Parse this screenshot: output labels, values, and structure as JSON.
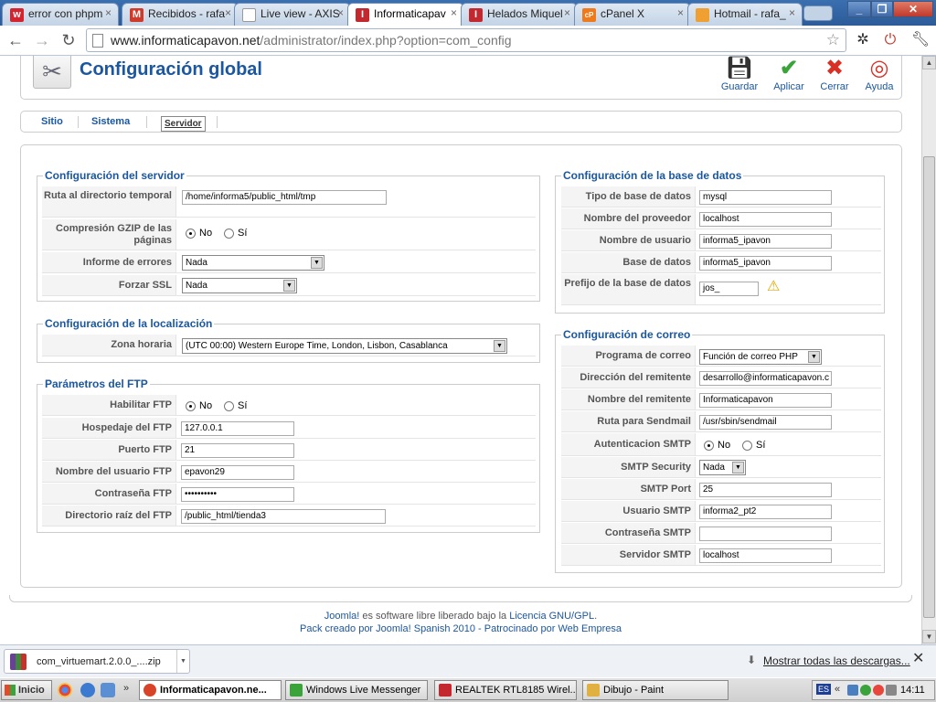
{
  "browser": {
    "tabs": [
      {
        "label": "error con phpm",
        "fav": "w",
        "color": "#d4222e"
      },
      {
        "label": "Recibidos - rafa",
        "fav": "M",
        "color": "#d03a2a"
      },
      {
        "label": "Live view - AXIS",
        "fav": "",
        "color": "#ffffff"
      },
      {
        "label": "Informaticapav",
        "fav": "I",
        "color": "#c3282e"
      },
      {
        "label": "Helados Miquel",
        "fav": "I",
        "color": "#c3282e"
      },
      {
        "label": "cPanel X",
        "fav": "cP",
        "color": "#f07a1a"
      },
      {
        "label": "Hotmail - rafa_",
        "fav": "",
        "color": "#f0a030"
      }
    ],
    "url_domain": "www.informaticapavon.net",
    "url_path": "/administrator/index.php?option=com_config"
  },
  "header": {
    "title": "Configuración global",
    "buttons": {
      "save": "Guardar",
      "apply": "Aplicar",
      "close": "Cerrar",
      "help": "Ayuda"
    }
  },
  "subtabs": [
    "Sitio",
    "Sistema",
    "Servidor"
  ],
  "server": {
    "legend": "Configuración del servidor",
    "tmp_label": "Ruta al directorio temporal",
    "tmp_value": "/home/informa5/public_html/tmp",
    "gzip_label": "Compresión GZIP de las páginas",
    "errors_label": "Informe de errores",
    "errors_value": "Nada",
    "ssl_label": "Forzar SSL",
    "ssl_value": "Nada"
  },
  "locale": {
    "legend": "Configuración de la localización",
    "tz_label": "Zona horaria",
    "tz_value": "(UTC 00:00) Western Europe Time, London, Lisbon, Casablanca"
  },
  "ftp": {
    "legend": "Parámetros del FTP",
    "enable_label": "Habilitar FTP",
    "host_label": "Hospedaje del FTP",
    "host_value": "127.0.0.1",
    "port_label": "Puerto FTP",
    "port_value": "21",
    "user_label": "Nombre del usuario FTP",
    "user_value": "epavon29",
    "pass_label": "Contraseña FTP",
    "pass_value": "••••••••••",
    "root_label": "Directorio raíz del FTP",
    "root_value": "/public_html/tienda3"
  },
  "db": {
    "legend": "Configuración de la base de datos",
    "type_label": "Tipo de base de datos",
    "type_value": "mysql",
    "host_label": "Nombre del proveedor",
    "host_value": "localhost",
    "user_label": "Nombre de usuario",
    "user_value": "informa5_ipavon",
    "name_label": "Base de datos",
    "name_value": "informa5_ipavon",
    "prefix_label": "Prefijo de la base de datos",
    "prefix_value": "jos_"
  },
  "mail": {
    "legend": "Configuración de correo",
    "mailer_label": "Programa de correo",
    "mailer_value": "Función de correo PHP",
    "from_label": "Dirección del remitente",
    "from_value": "desarrollo@informaticapavon.c",
    "fromname_label": "Nombre del remitente",
    "fromname_value": "Informaticapavon",
    "sendmail_label": "Ruta para Sendmail",
    "sendmail_value": "/usr/sbin/sendmail",
    "smtpauth_label": "Autenticacion SMTP",
    "smtpsec_label": "SMTP Security",
    "smtpsec_value": "Nada",
    "smtpport_label": "SMTP Port",
    "smtpport_value": "25",
    "smtpuser_label": "Usuario SMTP",
    "smtpuser_value": "informa2_pt2",
    "smtppass_label": "Contraseña SMTP",
    "smtppass_value": "",
    "smtphost_label": "Servidor SMTP",
    "smtphost_value": "localhost"
  },
  "radio": {
    "no": "No",
    "yes": "Sí"
  },
  "footer": {
    "joomla": "Joomla!",
    "line1_mid": " es software libre liberado bajo la ",
    "license": "Licencia GNU/GPL",
    "line1_end": ".",
    "line2": "Pack creado por Joomla! Spanish 2010 - Patrocinado por Web Empresa"
  },
  "downloads": {
    "file": "com_virtuemart.2.0.0_....zip",
    "show_all": "Mostrar todas las descargas..."
  },
  "taskbar": {
    "start": "Inicio",
    "items": [
      {
        "label": "Informaticapavon.ne...",
        "color": "#d9432a"
      },
      {
        "label": "Windows Live Messenger",
        "color": "#3aa33a"
      },
      {
        "label": "REALTEK RTL8185 Wirel...",
        "color": "#c3282e"
      },
      {
        "label": "Dibujo - Paint",
        "color": "#e0b040"
      }
    ],
    "lang": "ES",
    "time": "14:11"
  }
}
